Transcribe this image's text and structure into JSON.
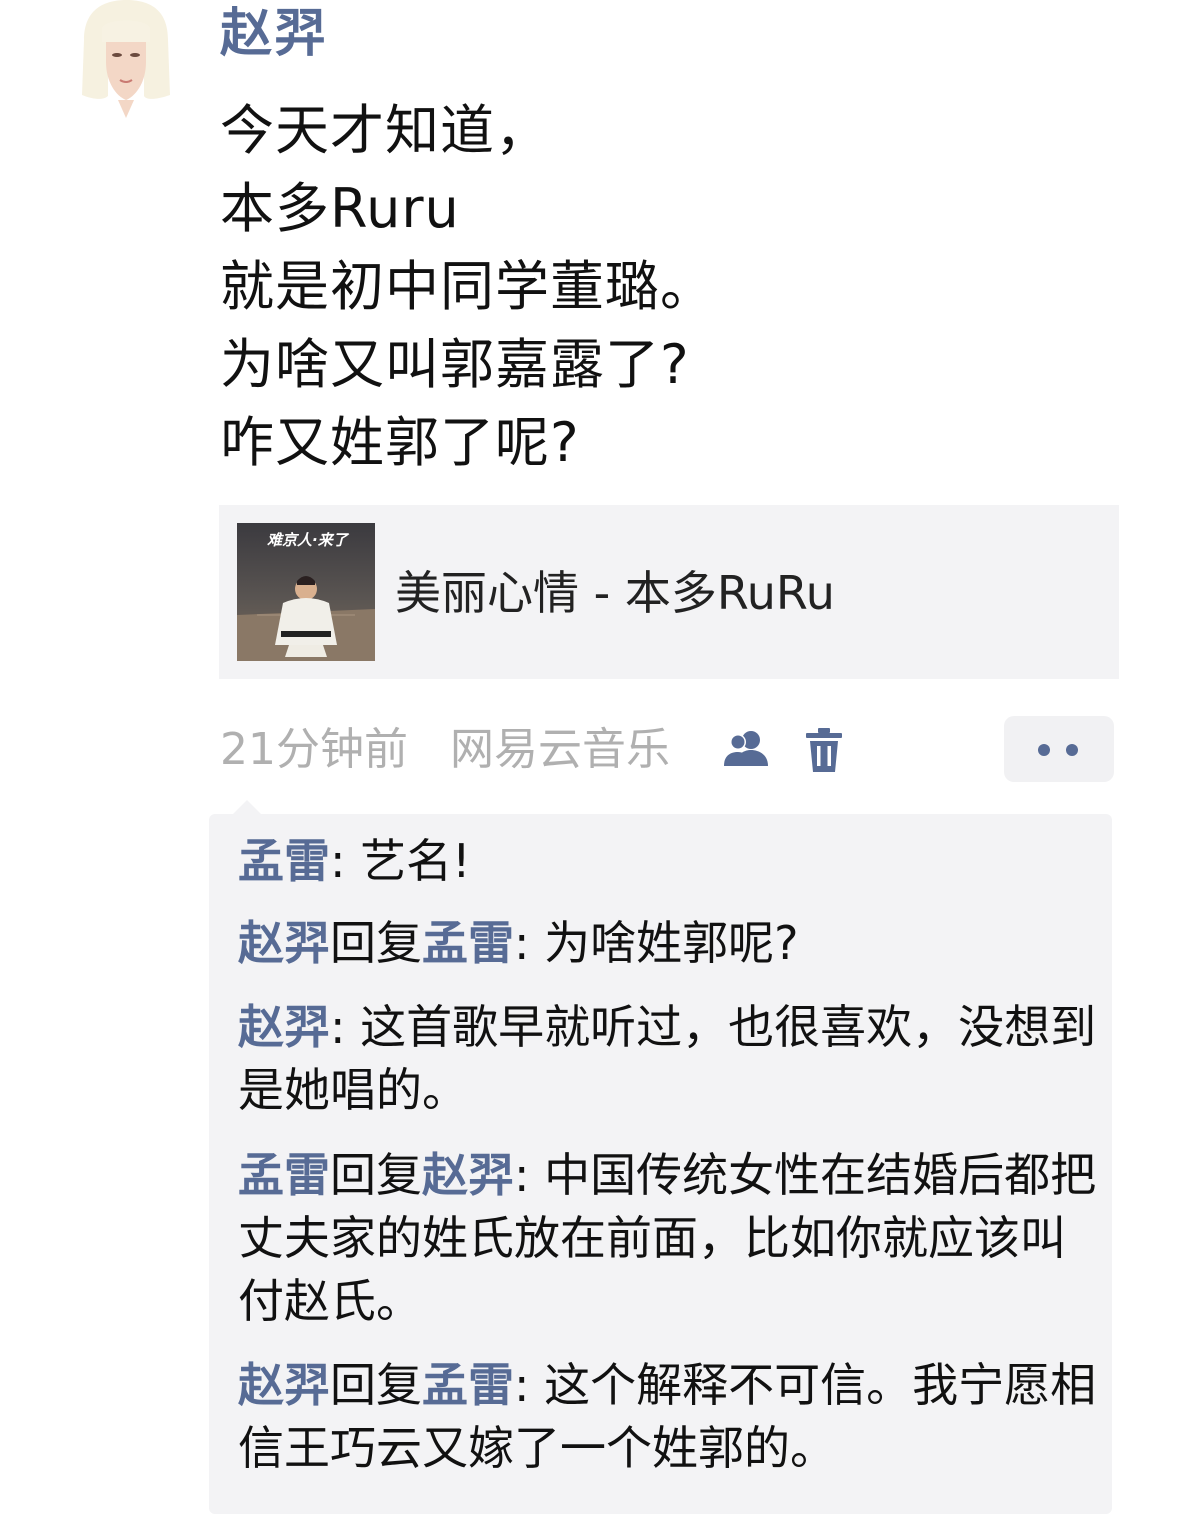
{
  "post": {
    "author": "赵羿",
    "lines": [
      "今天才知道，",
      "本多Ruru",
      "就是初中同学董璐。",
      "为啥又叫郭嘉露了?",
      "咋又姓郭了呢?"
    ]
  },
  "music": {
    "title": "美丽心情 - 本多RuRu",
    "album_text": "难京人·来了"
  },
  "meta": {
    "time": "21分钟前",
    "source": "网易云音乐"
  },
  "icons": {
    "avatar": "avatar-illustration",
    "visibility": "people-icon",
    "delete": "trash-icon",
    "more": "more-dots-icon"
  },
  "colors": {
    "name": "#576b95",
    "meta": "#b0b0b0",
    "panel": "#f3f3f5"
  },
  "comments": [
    {
      "from": "孟雷",
      "reply_word": "",
      "to": "",
      "sep": ": ",
      "text": "艺名!"
    },
    {
      "from": "赵羿",
      "reply_word": "回复",
      "to": "孟雷",
      "sep": ": ",
      "text": "为啥姓郭呢?"
    },
    {
      "from": "赵羿",
      "reply_word": "",
      "to": "",
      "sep": ": ",
      "text": "这首歌早就听过，也很喜欢，没想到是她唱的。"
    },
    {
      "from": "孟雷",
      "reply_word": "回复",
      "to": "赵羿",
      "sep": ": ",
      "text": "中国传统女性在结婚后都把丈夫家的姓氏放在前面，比如你就应该叫付赵氏。"
    },
    {
      "from": "赵羿",
      "reply_word": "回复",
      "to": "孟雷",
      "sep": ": ",
      "text": "这个解释不可信。我宁愿相信王巧云又嫁了一个姓郭的。"
    }
  ]
}
